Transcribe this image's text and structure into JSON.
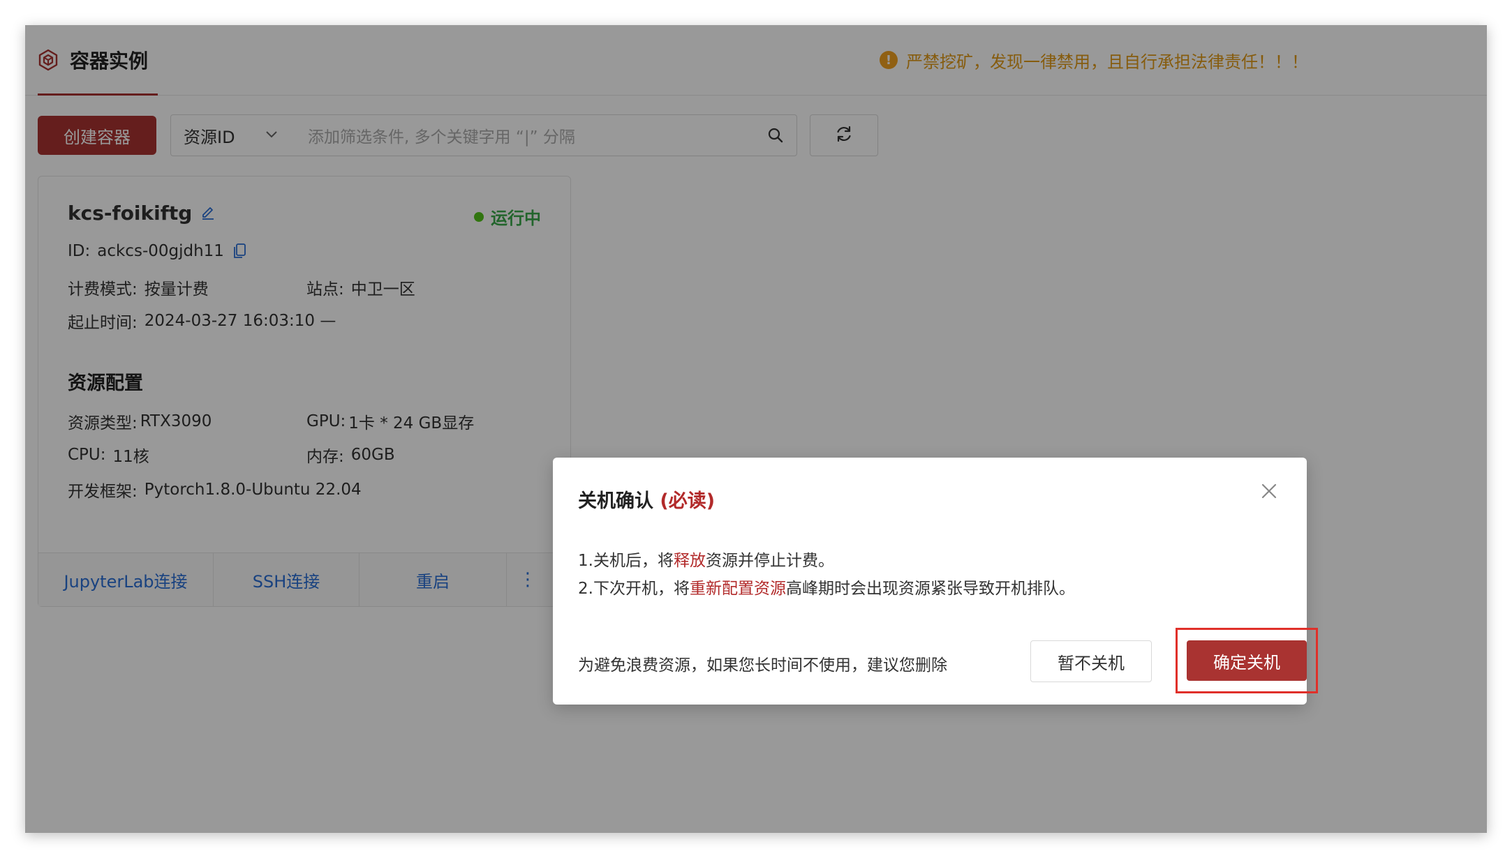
{
  "header": {
    "tab_label": "容器实例",
    "warning_text": "严禁挖矿，发现一律禁用，且自行承担法律责任！！！"
  },
  "toolbar": {
    "create_label": "创建容器",
    "select_value": "资源ID",
    "search_placeholder": "添加筛选条件, 多个关键字用 “|” 分隔"
  },
  "card": {
    "name": "kcs-foikiftg",
    "status": "运行中",
    "id_label": "ID:",
    "id_value": "ackcs-00gjdh11",
    "billing_label": "计费模式:",
    "billing_value": "按量计费",
    "site_label": "站点:",
    "site_value": "中卫一区",
    "time_label": "起止时间:",
    "time_value": "2024-03-27 16:03:10 —",
    "section_title": "资源配置",
    "res_type_label": "资源类型:",
    "res_type_value": "RTX3090",
    "gpu_label": "GPU:",
    "gpu_value": "1卡 * 24 GB显存",
    "cpu_label": "CPU:",
    "cpu_value": "11核",
    "mem_label": "内存:",
    "mem_value": "60GB",
    "framework_label": "开发框架:",
    "framework_value": "Pytorch1.8.0-Ubuntu 22.04",
    "actions": {
      "jupyter": "JupyterLab连接",
      "ssh": "SSH连接",
      "restart": "重启",
      "more": "⋮"
    }
  },
  "modal": {
    "title": "关机确认",
    "title_must": "(必读)",
    "line1_a": "1.关机后，将",
    "line1_red": "释放",
    "line1_b": "资源并停止计费。",
    "line2_a": "2.下次开机，将",
    "line2_red": "重新配置资源",
    "line2_b": "高峰期时会出现资源紧张导致开机排队。",
    "hint": "为避免浪费资源，如果您长时间不使用，建议您删除",
    "cancel_label": "暂不关机",
    "confirm_label": "确定关机"
  },
  "colors": {
    "primary": "#a93331",
    "warning": "#e09a18",
    "running": "#3aa84a",
    "link": "#2a6fd6",
    "highlight": "#e0302a"
  }
}
